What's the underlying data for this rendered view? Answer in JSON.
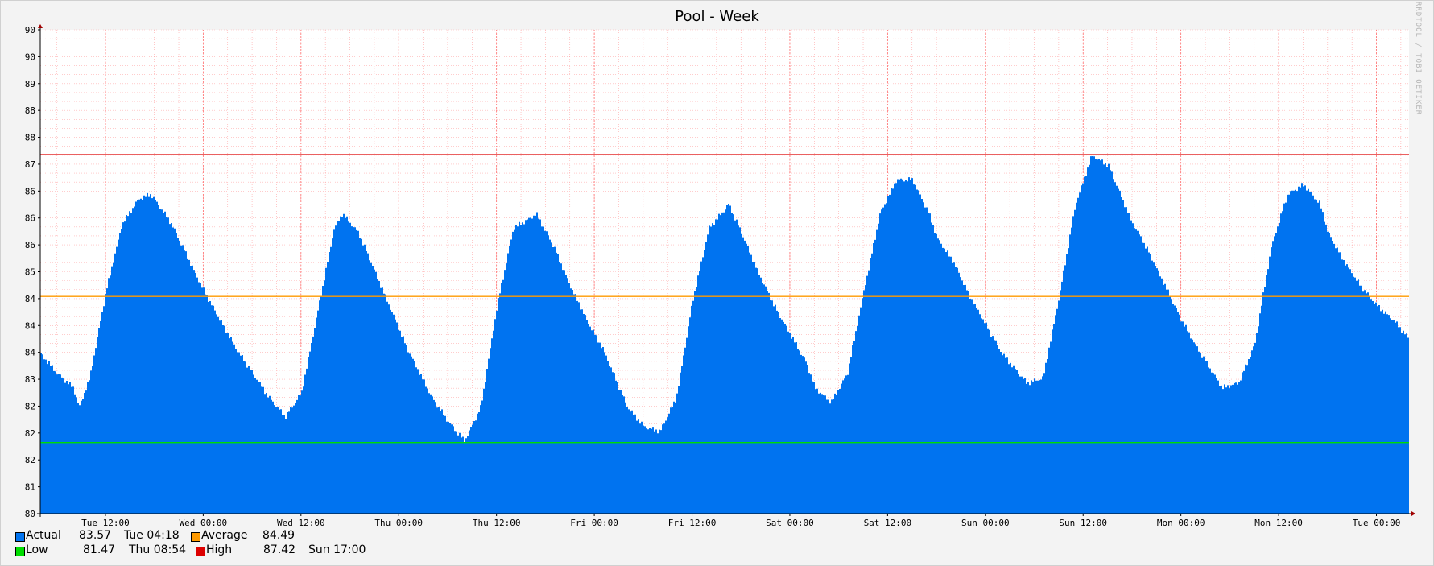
{
  "title": "Pool - Week",
  "watermark": "RRDTOOL / TOBI OETIKER",
  "colors": {
    "background": "#f3f3f3",
    "canvas": "#ffffff",
    "actual": "#0073f0",
    "average": "#ff9a00",
    "low": "#00dd00",
    "high": "#dd0000",
    "grid": "#ff9a9a"
  },
  "legend": {
    "actual": {
      "label": "Actual",
      "value": "83.57",
      "time": "Tue 04:18",
      "color": "#0073f0"
    },
    "average": {
      "label": "Average",
      "value": "84.49",
      "color": "#ff9a00"
    },
    "low": {
      "label": "Low",
      "value": "81.47",
      "time": "Thu 08:54",
      "color": "#00dd00"
    },
    "high": {
      "label": "High",
      "value": "87.42",
      "time": "Sun 17:00",
      "color": "#dd0000"
    }
  },
  "chart_data": {
    "type": "area",
    "title": "Pool - Week",
    "xlabel": "",
    "ylabel": "",
    "ylim": [
      80,
      90
    ],
    "y_tick_labels": [
      "80",
      "81",
      "82",
      "82",
      "82",
      "83",
      "84",
      "84",
      "84",
      "85",
      "86",
      "86",
      "86",
      "87",
      "88",
      "88",
      "89",
      "90",
      "90"
    ],
    "x_tick_labels": [
      "Tue 12:00",
      "Wed 00:00",
      "Wed 12:00",
      "Thu 00:00",
      "Thu 12:00",
      "Fri 00:00",
      "Fri 12:00",
      "Sat 00:00",
      "Sat 12:00",
      "Sun 00:00",
      "Sun 12:00",
      "Mon 00:00",
      "Mon 12:00",
      "Tue 00:00"
    ],
    "x_range_hours": [
      -8,
      160
    ],
    "grid": true,
    "series": [
      {
        "name": "Actual",
        "style": "area",
        "points_hours": [
          -8,
          -6,
          -4,
          -3.3,
          -2,
          0,
          2,
          4,
          5.5,
          8,
          10,
          12,
          14,
          16,
          18,
          20,
          22,
          24,
          26,
          28,
          29,
          31,
          33,
          35,
          37,
          38.5,
          40,
          42,
          44,
          46,
          48,
          50,
          52,
          52.8,
          55,
          57,
          59,
          61,
          62.5,
          64,
          66,
          68,
          70,
          72,
          74,
          76,
          76.4,
          78,
          80,
          82,
          84,
          86,
          87,
          89,
          91,
          93,
          95,
          97,
          99,
          101,
          102,
          104,
          106,
          108,
          110,
          111.5,
          113,
          115,
          117,
          119,
          121,
          123,
          125,
          126,
          128,
          130,
          132,
          134,
          135.5,
          137,
          139,
          141,
          143,
          145,
          147,
          149,
          150,
          152,
          154,
          156,
          158,
          160
        ],
        "values": [
          83.3,
          82.9,
          82.6,
          82.2,
          82.8,
          84.6,
          86.0,
          86.5,
          86.6,
          86.0,
          85.3,
          84.6,
          84.0,
          83.4,
          82.9,
          82.4,
          82.0,
          82.5,
          84.2,
          85.9,
          86.2,
          85.8,
          85.0,
          84.2,
          83.4,
          82.9,
          82.4,
          81.9,
          81.5,
          82.2,
          84.3,
          85.9,
          86.1,
          86.2,
          85.5,
          84.7,
          84.0,
          83.4,
          82.8,
          82.2,
          81.8,
          81.7,
          82.4,
          84.4,
          85.9,
          86.3,
          86.4,
          85.8,
          85.0,
          84.3,
          83.7,
          83.1,
          82.6,
          82.3,
          82.9,
          84.6,
          86.2,
          86.9,
          86.9,
          86.2,
          85.7,
          85.2,
          84.5,
          83.9,
          83.3,
          83.0,
          82.7,
          82.8,
          84.5,
          86.4,
          87.4,
          87.2,
          86.4,
          86.0,
          85.4,
          84.7,
          84.0,
          83.4,
          83.0,
          82.6,
          82.7,
          83.5,
          85.5,
          86.6,
          86.8,
          86.4,
          85.8,
          85.2,
          84.7,
          84.3,
          84.0,
          83.6
        ]
      },
      {
        "name": "Average",
        "style": "line",
        "value": 84.49
      },
      {
        "name": "Low",
        "style": "line",
        "value": 81.47
      },
      {
        "name": "High",
        "style": "line",
        "value": 87.42
      }
    ]
  }
}
